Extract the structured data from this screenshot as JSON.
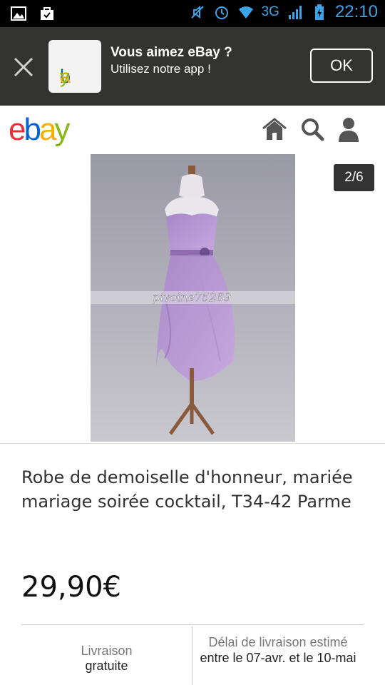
{
  "status_bar": {
    "network": "3G",
    "time": "22:10",
    "accent_color": "#3da3e8",
    "icons": [
      "image-icon",
      "shopping-bag-icon",
      "mute-icon",
      "alarm-icon",
      "wifi-icon",
      "signal-icon",
      "battery-charging-icon"
    ]
  },
  "app_banner": {
    "app_logo_text": "ebay",
    "title": "Vous aimez eBay ?",
    "subtitle": "Utilisez notre app !",
    "ok_label": "OK",
    "background": "#333432"
  },
  "header": {
    "logo": {
      "e": "e",
      "b": "b",
      "a": "a",
      "y": "y"
    },
    "logo_colors": {
      "e": "#e53238",
      "b": "#0064d2",
      "a": "#f5af02",
      "y": "#86b817"
    },
    "icons": [
      "home-icon",
      "search-icon",
      "user-icon"
    ]
  },
  "gallery": {
    "counter": "2/6",
    "watermark": "pivoine75269"
  },
  "listing": {
    "title": "Robe de demoiselle d'honneur, mariée mariage soirée cocktail, T34-42 Parme",
    "price": "29,90€"
  },
  "shipping": {
    "label": "Livraison",
    "value": "gratuite"
  },
  "delivery": {
    "label": "Délai de livraison estimé",
    "value": "entre le 07-avr. et le 10-mai"
  }
}
